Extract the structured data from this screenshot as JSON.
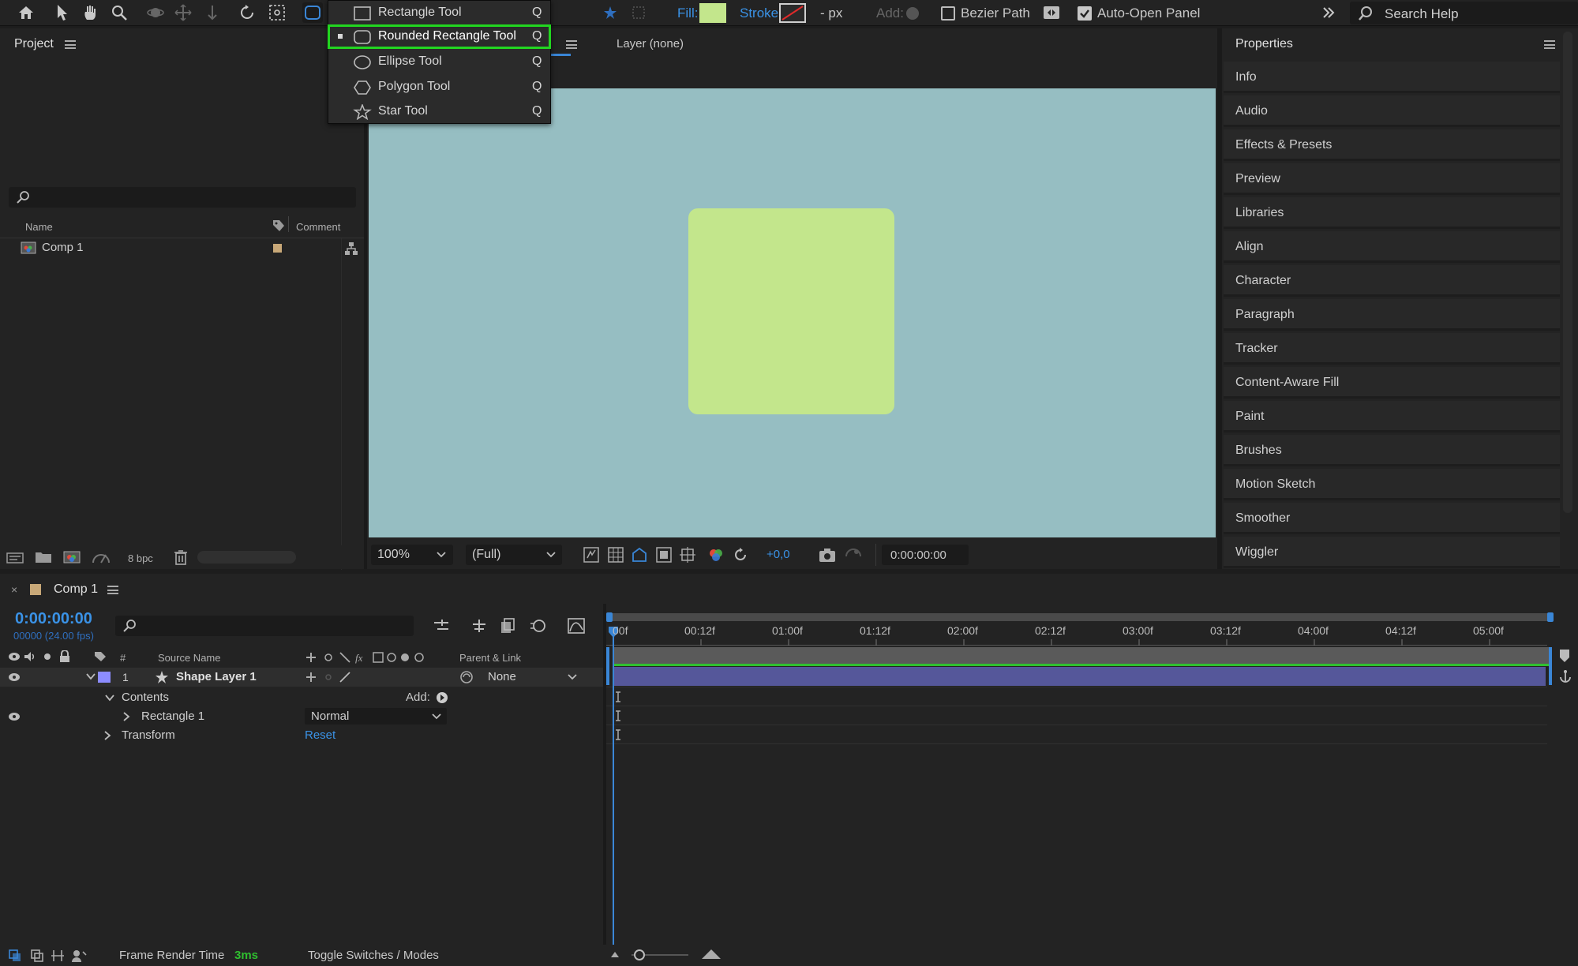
{
  "toolbar": {
    "fill_label": "Fill:",
    "stroke_label": "Stroke:",
    "stroke_width": "- px",
    "add_label": "Add:",
    "bezier_path_label": "Bezier Path",
    "auto_open_label": "Auto-Open Panel",
    "search_placeholder": "Search Help",
    "fill_color": "#c3e68c"
  },
  "shape_menu": {
    "items": [
      {
        "label": "Rectangle Tool",
        "key": "Q",
        "icon": "rectangle-icon"
      },
      {
        "label": "Rounded Rectangle Tool",
        "key": "Q",
        "icon": "rounded-rectangle-icon",
        "selected": true
      },
      {
        "label": "Ellipse Tool",
        "key": "Q",
        "icon": "ellipse-icon"
      },
      {
        "label": "Polygon Tool",
        "key": "Q",
        "icon": "polygon-icon"
      },
      {
        "label": "Star Tool",
        "key": "Q",
        "icon": "star-icon"
      }
    ],
    "highlight_color": "#22d620"
  },
  "project": {
    "title": "Project",
    "col_name": "Name",
    "col_comment": "Comment",
    "items": [
      {
        "name": "Comp 1"
      }
    ],
    "bpc": "8 bpc"
  },
  "viewer": {
    "layer_tab": "Layer (none)",
    "zoom": "100%",
    "resolution": "(Full)",
    "exposure": "+0,0",
    "timecode": "0:00:00:00",
    "bg_color": "#96bec2",
    "shape_color": "#c3e68c"
  },
  "properties": {
    "title": "Properties",
    "panels": [
      "Info",
      "Audio",
      "Effects & Presets",
      "Preview",
      "Libraries",
      "Align",
      "Character",
      "Paragraph",
      "Tracker",
      "Content-Aware Fill",
      "Paint",
      "Brushes",
      "Motion Sketch",
      "Smoother",
      "Wiggler"
    ]
  },
  "timeline": {
    "comp_tab": "Comp 1",
    "current_time": "0:00:00:00",
    "frame_info": "00000 (24.00 fps)",
    "col_hash": "#",
    "col_source": "Source Name",
    "col_parent": "Parent & Link",
    "layer": {
      "num": "1",
      "name": "Shape Layer 1",
      "parent": "None"
    },
    "contents_label": "Contents",
    "add_label": "Add:",
    "rect_label": "Rectangle 1",
    "blend_mode": "Normal",
    "transform_label": "Transform",
    "reset_label": "Reset",
    "ruler": [
      "00f",
      "00:12f",
      "01:00f",
      "01:12f",
      "02:00f",
      "02:12f",
      "03:00f",
      "03:12f",
      "04:00f",
      "04:12f",
      "05:00f"
    ],
    "frame_render_label": "Frame Render Time",
    "frame_render_value": "3ms",
    "toggle_label": "Toggle Switches / Modes"
  }
}
